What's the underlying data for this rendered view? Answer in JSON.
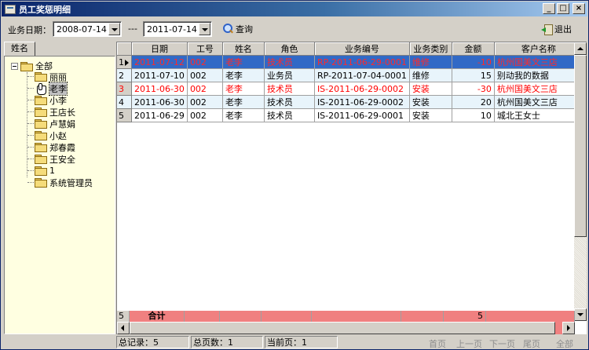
{
  "window": {
    "title": "员工奖惩明细"
  },
  "toolbar": {
    "date_label": "业务日期：",
    "date_from": "2008-07-14",
    "date_sep": "---",
    "date_to": "2011-07-14",
    "query_label": "查询",
    "exit_label": "退出"
  },
  "left": {
    "tab_label": "姓名",
    "root": "全部",
    "items": [
      "丽丽",
      "老李",
      "小李",
      "王店长",
      "卢慧娟",
      "小赵",
      "郑春霞",
      "王安全",
      "1",
      "系统管理员"
    ],
    "selected_index": 1
  },
  "grid": {
    "columns": [
      "日期",
      "工号",
      "姓名",
      "角色",
      "业务编号",
      "业务类别",
      "金额",
      "客户名称"
    ],
    "rows": [
      {
        "num": "1",
        "date": "2011-07-12",
        "id": "002",
        "name": "老李",
        "role": "技术员",
        "biz_no": "RP-2011-06-29-0001",
        "type": "维修",
        "amount": "-10",
        "customer": "杭州国美文三店",
        "style": "selected"
      },
      {
        "num": "2",
        "date": "2011-07-10",
        "id": "002",
        "name": "老李",
        "role": "业务员",
        "biz_no": "RP-2011-07-04-0001",
        "type": "维修",
        "amount": "15",
        "customer": "别动我的数据",
        "style": "alt"
      },
      {
        "num": "3",
        "date": "2011-06-30",
        "id": "002",
        "name": "老李",
        "role": "技术员",
        "biz_no": "IS-2011-06-29-0002",
        "type": "安装",
        "amount": "-30",
        "customer": "杭州国美文三店",
        "style": "red"
      },
      {
        "num": "4",
        "date": "2011-06-30",
        "id": "002",
        "name": "老李",
        "role": "技术员",
        "biz_no": "IS-2011-06-29-0002",
        "type": "安装",
        "amount": "20",
        "customer": "杭州国美文三店",
        "style": "alt"
      },
      {
        "num": "5",
        "date": "2011-06-29",
        "id": "002",
        "name": "老李",
        "role": "技术员",
        "biz_no": "IS-2011-06-29-0001",
        "type": "安装",
        "amount": "10",
        "customer": "城北王女士",
        "style": ""
      }
    ],
    "summary": {
      "count": "5",
      "label": "合计",
      "amount": "5"
    }
  },
  "status": {
    "total_records": "总记录：5",
    "total_pages": "总页数：1",
    "current_page": "当前页：1",
    "nav": [
      "首页",
      "上一页",
      "下一页",
      "尾页",
      "全部"
    ]
  },
  "colors": {
    "selected_row": "#3169c6",
    "summary": "#f08080",
    "red_text": "#ff0000",
    "tree_bg": "#ffffe1"
  }
}
